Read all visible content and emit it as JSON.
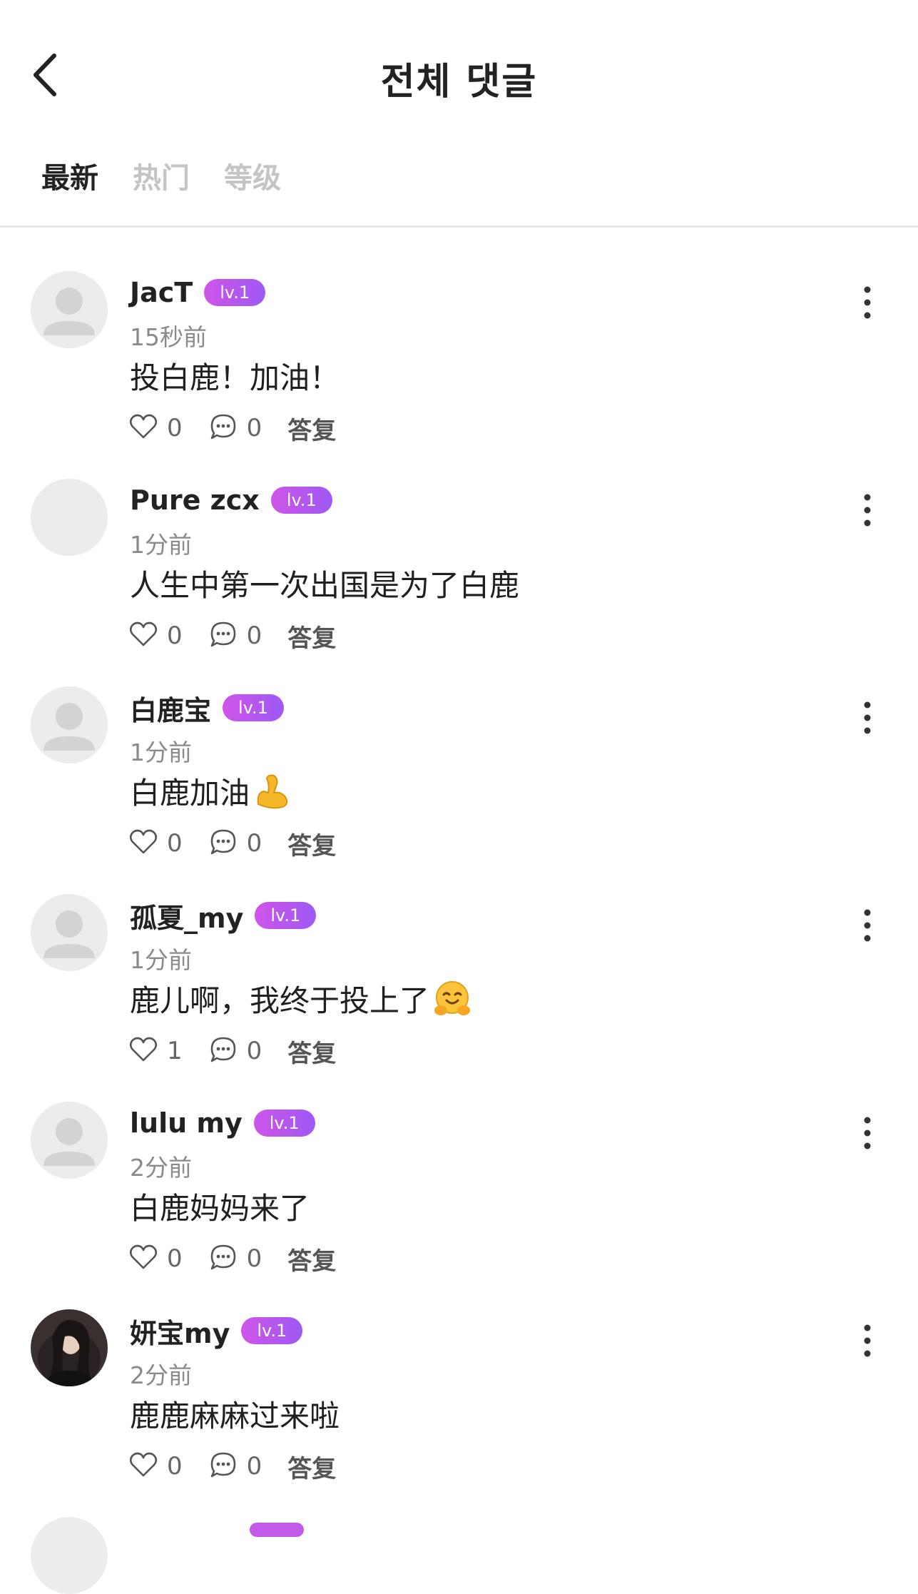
{
  "header": {
    "title": "전체 댓글"
  },
  "tabs": [
    {
      "label": "最新",
      "active": true
    },
    {
      "label": "热门",
      "active": false
    },
    {
      "label": "等级",
      "active": false
    }
  ],
  "reply_label": "答复",
  "comments": [
    {
      "username": "JacT",
      "level": "lv.1",
      "time": "15秒前",
      "text": "投白鹿！加油！",
      "emoji": "",
      "likes": "0",
      "replies": "0",
      "avatar": "default"
    },
    {
      "username": "Pure zcx",
      "level": "lv.1",
      "time": "1分前",
      "text": "人生中第一次出国是为了白鹿",
      "emoji": "",
      "likes": "0",
      "replies": "0",
      "avatar": "blank"
    },
    {
      "username": "白鹿宝",
      "level": "lv.1",
      "time": "1分前",
      "text": "白鹿加油",
      "emoji": "flexed-biceps-emoji",
      "likes": "0",
      "replies": "0",
      "avatar": "default"
    },
    {
      "username": "孤夏_my",
      "level": "lv.1",
      "time": "1分前",
      "text": "鹿儿啊，我终于投上了",
      "emoji": "hugging-face-emoji",
      "likes": "1",
      "replies": "0",
      "avatar": "default"
    },
    {
      "username": "lulu my",
      "level": "lv.1",
      "time": "2分前",
      "text": "白鹿妈妈来了",
      "emoji": "",
      "likes": "0",
      "replies": "0",
      "avatar": "default"
    },
    {
      "username": "妍宝my",
      "level": "lv.1",
      "time": "2分前",
      "text": "鹿鹿麻麻过来啦",
      "emoji": "",
      "likes": "0",
      "replies": "0",
      "avatar": "photo"
    }
  ],
  "colors": {
    "level_badge": "#c45be8",
    "active_tab": "#222222",
    "inactive_tab": "#c4c4c4",
    "divider": "#e7e7e7"
  }
}
